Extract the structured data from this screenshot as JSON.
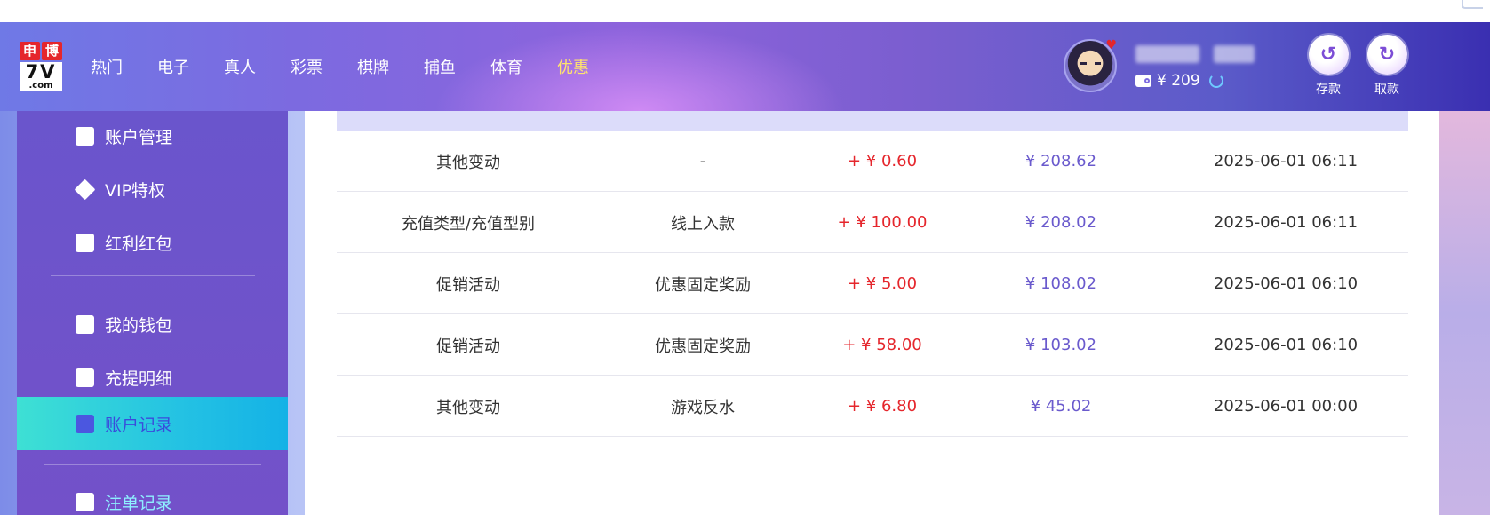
{
  "brand": {
    "logo_cn": [
      "申",
      "博"
    ],
    "logo_num": "7V",
    "logo_domain": ".com"
  },
  "nav": {
    "items": [
      {
        "label": "热门"
      },
      {
        "label": "电子"
      },
      {
        "label": "真人"
      },
      {
        "label": "彩票"
      },
      {
        "label": "棋牌"
      },
      {
        "label": "捕鱼"
      },
      {
        "label": "体育"
      },
      {
        "label": "优惠",
        "active": true
      }
    ]
  },
  "user": {
    "balance": "¥ 209"
  },
  "actions": {
    "deposit_label": "存款",
    "withdraw_label": "取款"
  },
  "sidebar": {
    "items": [
      {
        "label": "账户管理",
        "icon": "card-icon"
      },
      {
        "label": "VIP特权",
        "icon": "diamond-icon"
      },
      {
        "label": "红利红包",
        "icon": "envelope-icon"
      },
      {
        "label": "我的钱包",
        "icon": "wallet-icon"
      },
      {
        "label": "充提明细",
        "icon": "document-icon"
      },
      {
        "label": "账户记录",
        "icon": "clipboard-icon",
        "active": true
      },
      {
        "label": "注单记录",
        "icon": "edit-icon"
      }
    ]
  },
  "records": [
    {
      "type": "其他变动",
      "detail": "-",
      "amount": "+ ¥ 0.60",
      "balance": "¥ 208.62",
      "time": "2025-06-01 06:11"
    },
    {
      "type": "充值类型/充值型别",
      "detail": "线上入款",
      "amount": "+ ¥ 100.00",
      "balance": "¥ 208.02",
      "time": "2025-06-01 06:11"
    },
    {
      "type": "促销活动",
      "detail": "优惠固定奖励",
      "amount": "+ ¥ 5.00",
      "balance": "¥ 108.02",
      "time": "2025-06-01 06:10"
    },
    {
      "type": "促销活动",
      "detail": "优惠固定奖励",
      "amount": "+ ¥ 58.00",
      "balance": "¥ 103.02",
      "time": "2025-06-01 06:10"
    },
    {
      "type": "其他变动",
      "detail": "游戏反水",
      "amount": "+ ¥ 6.80",
      "balance": "¥ 45.02",
      "time": "2025-06-01 00:00"
    }
  ],
  "colors": {
    "accent_gold": "#ffe36e",
    "positive_red": "#e5262c",
    "balance_purple": "#6a5acd",
    "active_cyan": "#24c2e3"
  }
}
